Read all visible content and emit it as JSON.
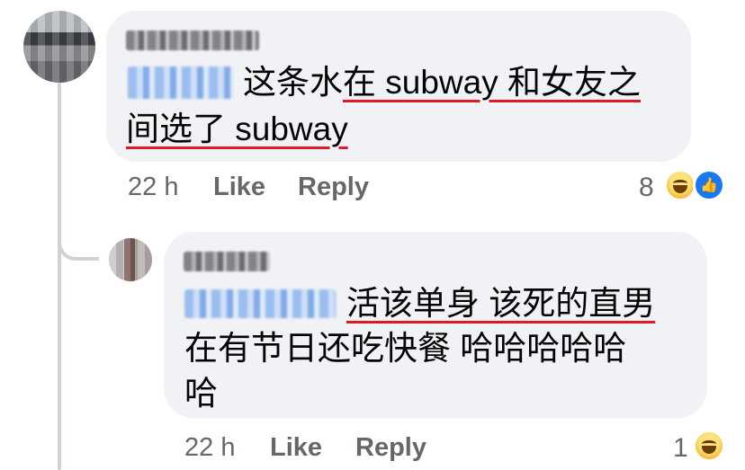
{
  "comments": [
    {
      "avatar_icon": "avatar",
      "author_name_obscured": true,
      "mention_obscured": true,
      "text_line1_plain": "这条水",
      "text_line1_underlined": "在 subway 和女友之",
      "text_line2_underlined": "间选了 subway",
      "time": "22 h",
      "like_label": "Like",
      "reply_label": "Reply",
      "reaction_count": "8",
      "reactions": [
        "haha-icon",
        "like-icon"
      ]
    },
    {
      "avatar_icon": "avatar",
      "author_name_obscured": true,
      "mention_obscured": true,
      "text_line1_underlined": "活该单身 该死的直男",
      "text_line2": "在有节日还吃快餐 哈哈哈哈哈",
      "text_line3": "哈",
      "time": "22 h",
      "like_label": "Like",
      "reply_label": "Reply",
      "reaction_count": "1",
      "reactions": [
        "haha-icon"
      ]
    }
  ],
  "colors": {
    "bubble_bg": "#f0f2f5",
    "text": "#050505",
    "meta": "#65676b",
    "underline": "#e01a22",
    "mention": "#1877f2"
  }
}
